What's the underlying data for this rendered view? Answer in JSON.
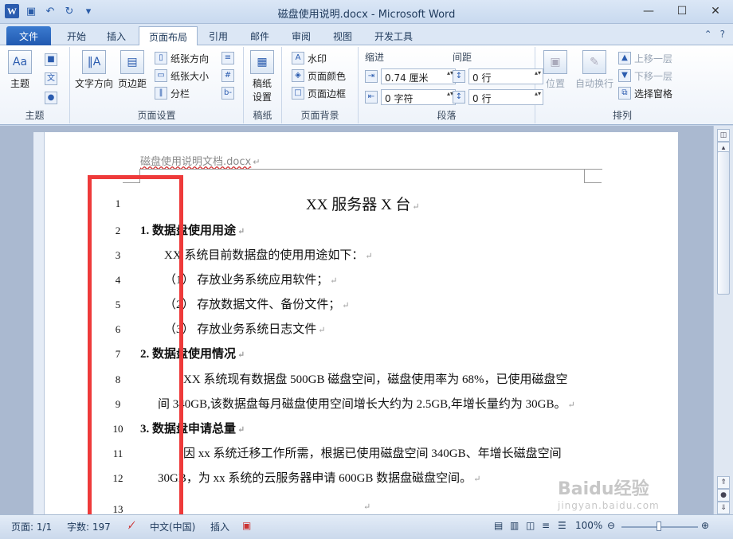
{
  "window": {
    "title": "磁盘使用说明.docx - Microsoft Word",
    "app_icon": "W"
  },
  "tabs": [
    "文件",
    "开始",
    "插入",
    "页面布局",
    "引用",
    "邮件",
    "审阅",
    "视图",
    "开发工具"
  ],
  "active_tab": "页面布局",
  "ribbon": {
    "theme": {
      "label": "主题",
      "group": "主题"
    },
    "page_setup": {
      "text_direction": "文字方向",
      "margins": "页边距",
      "paper_direction": "纸张方向",
      "paper_size": "纸张大小",
      "columns": "分栏",
      "group": "页面设置"
    },
    "draft": {
      "label": "稿纸\n设置",
      "label1": "稿纸",
      "label2": "设置",
      "group": "稿纸"
    },
    "page_background": {
      "watermark": "水印",
      "page_color": "页面颜色",
      "page_border": "页面边框",
      "group": "页面背景"
    },
    "paragraph": {
      "indent_label": "缩进",
      "spacing_label": "间距",
      "indent_left": "0.74 厘米",
      "indent_right": "0 字符",
      "spacing_before": "0 行",
      "spacing_after": "0 行",
      "group": "段落"
    },
    "arrange": {
      "position": "位置",
      "wrap": "自动换行",
      "bring_forward": "上移一层",
      "send_backward": "下移一层",
      "selection_pane": "选择窗格",
      "group": "排列"
    }
  },
  "document": {
    "header": "磁盘使用说明文档.docx",
    "lines": [
      {
        "n": "1",
        "text": "XX 服务器 X 台"
      },
      {
        "n": "2",
        "text": "1.  数据盘使用用途"
      },
      {
        "n": "3",
        "text": "XX 系统目前数据盘的使用用途如下："
      },
      {
        "n": "4",
        "text": "（1）  存放业务系统应用软件；"
      },
      {
        "n": "5",
        "text": "（2）  存放数据文件、备份文件；"
      },
      {
        "n": "6",
        "text": "（3）  存放业务系统日志文件"
      },
      {
        "n": "7",
        "text": "2. 数据盘使用情况"
      },
      {
        "n": "8",
        "text": "XX 系统现有数据盘 500GB 磁盘空间，磁盘使用率为 68%，已使用磁盘空"
      },
      {
        "n": "9",
        "text": "间 340GB,该数据盘每月磁盘使用空间增长大约为 2.5GB,年增长量约为 30GB。"
      },
      {
        "n": "10",
        "text": "3. 数据盘申请总量"
      },
      {
        "n": "11",
        "text": "因 xx 系统迁移工作所需，根据已使用磁盘空间 340GB、年增长磁盘空间"
      },
      {
        "n": "12",
        "text": "30GB，为 xx 系统的云服务器申请 600GB 数据盘磁盘空间。"
      },
      {
        "n": "13",
        "text": ""
      }
    ]
  },
  "statusbar": {
    "page": "页面: 1/1",
    "words": "字数: 197",
    "language": "中文(中国)",
    "mode": "插入",
    "zoom": "100%"
  },
  "watermark": {
    "brand": "Baidu经验",
    "url": "jingyan.baidu.com"
  },
  "colors": {
    "accent": "#2b5caf",
    "highlight_box": "#ee3a3a"
  }
}
